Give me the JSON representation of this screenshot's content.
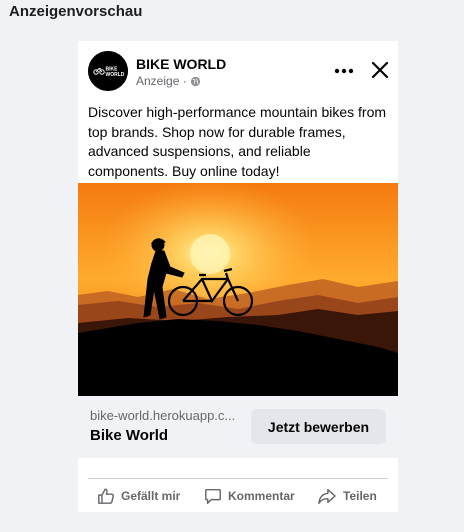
{
  "title": "Anzeigenvorschau",
  "ad": {
    "page_name": "BIKE WORLD",
    "sponsored_label": "Anzeige · ",
    "logo_text": {
      "top": "BIKE",
      "bottom": "WORLD"
    },
    "primary_text": "Discover high-performance mountain bikes from top brands. Shop now for durable frames, advanced suspensions, and reliable components. Buy online today!",
    "link_domain": "bike-world.herokuapp.c...",
    "link_title": "Bike World",
    "cta_label": "Jetzt bewerben",
    "image_description": "silhouette of cyclist with mountain bike at sunset"
  },
  "actions": {
    "like": "Gefällt mir",
    "comment": "Kommentar",
    "share": "Teilen"
  },
  "colors": {
    "background": "#f0f2f5",
    "secondary_text": "#65676b",
    "cta_bg": "#e4e6eb"
  },
  "icons": [
    "globe-icon",
    "more-options-icon",
    "close-icon",
    "like-icon",
    "comment-icon",
    "share-icon"
  ]
}
